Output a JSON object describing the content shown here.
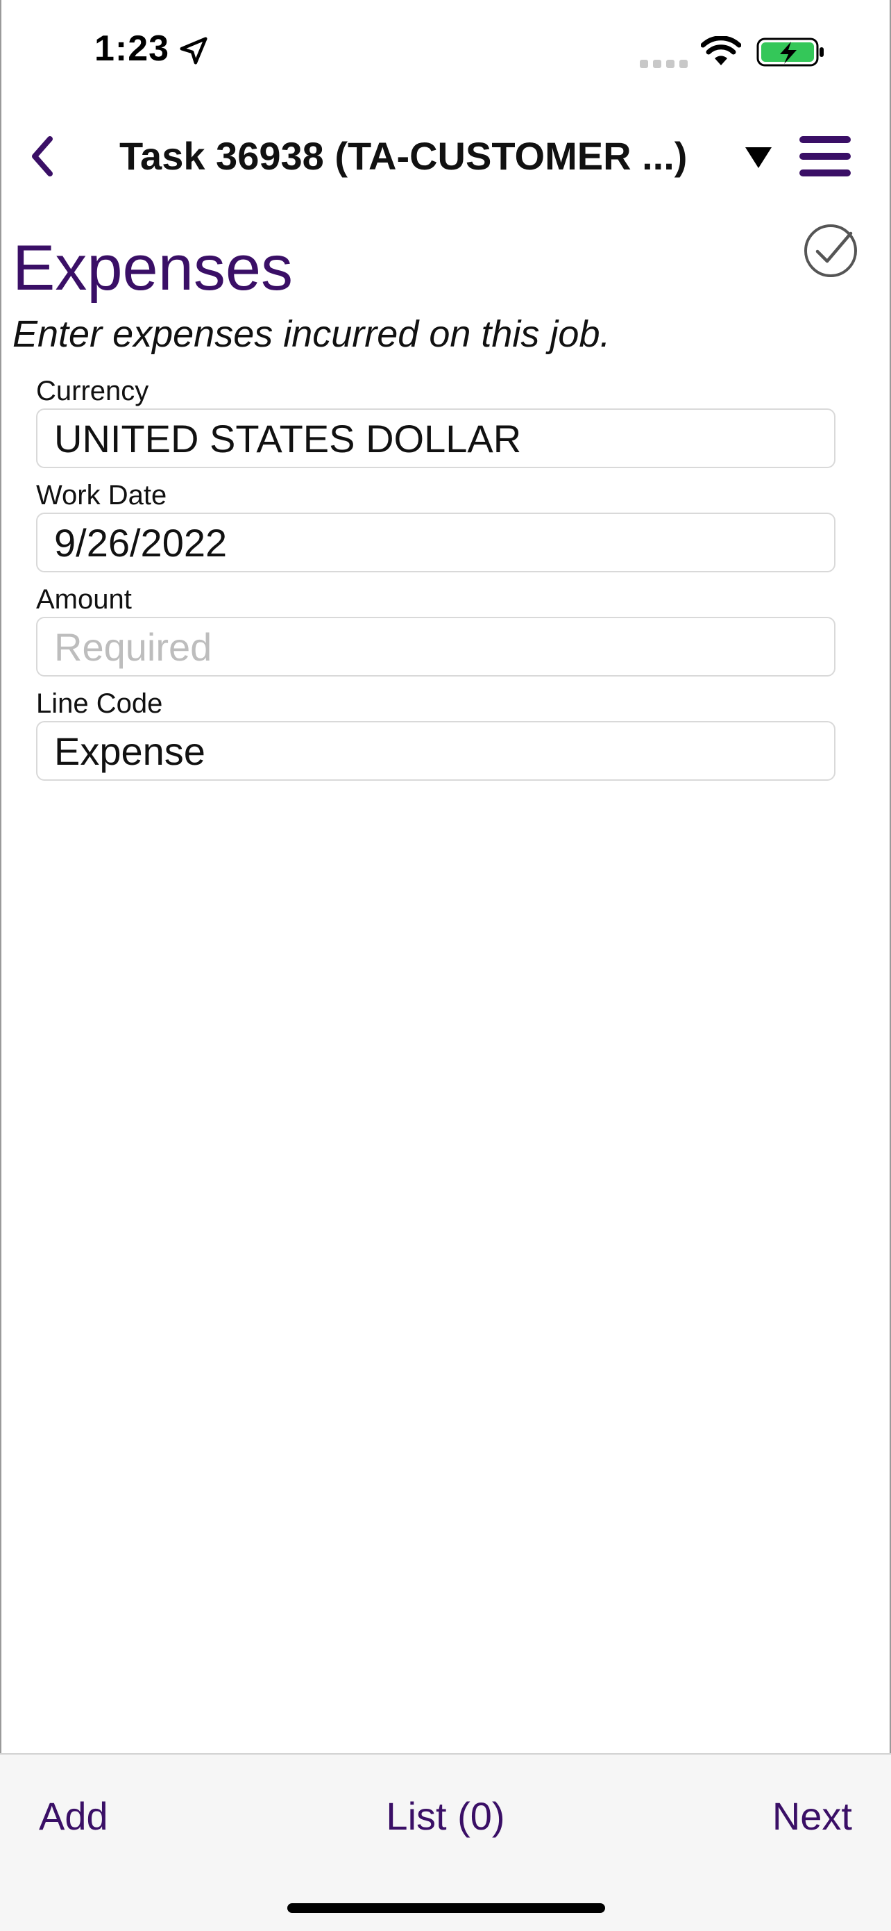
{
  "status_bar": {
    "time": "1:23",
    "icons": [
      "location-arrow-icon",
      "cellular-signal-icon",
      "wifi-icon",
      "battery-charging-icon"
    ],
    "battery_color": "#34c759"
  },
  "nav": {
    "title": "Task 36938 (TA-CUSTOMER ...)",
    "icons": [
      "chevron-left-icon",
      "dropdown-triangle-icon",
      "hamburger-menu-icon"
    ]
  },
  "header": {
    "title": "Expenses",
    "subtitle": "Enter expenses incurred on this job.",
    "check_icon": "checkmark-circle-icon"
  },
  "form": {
    "fields": [
      {
        "label": "Currency",
        "value": "UNITED STATES DOLLAR",
        "placeholder": ""
      },
      {
        "label": "Work Date",
        "value": "9/26/2022",
        "placeholder": ""
      },
      {
        "label": "Amount",
        "value": "",
        "placeholder": "Required"
      },
      {
        "label": "Line Code",
        "value": "Expense",
        "placeholder": ""
      }
    ]
  },
  "toolbar": {
    "add_label": "Add",
    "list_label": "List (0)",
    "next_label": "Next"
  },
  "colors": {
    "accent": "#3a0f66",
    "field_border": "#d9d9d9",
    "placeholder": "#bdbdbd",
    "toolbar_bg": "#f6f6f6"
  }
}
